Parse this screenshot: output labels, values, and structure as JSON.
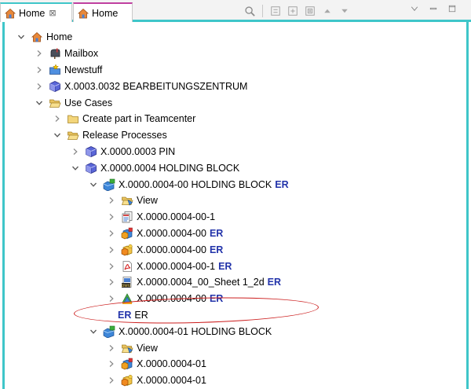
{
  "tabs": [
    {
      "label": "Home",
      "close": "⊠"
    },
    {
      "label": "Home"
    }
  ],
  "toolbar": {
    "icons": [
      "search-icon",
      "collapse-all-icon",
      "expand-icon",
      "expand-all-icon",
      "up-icon",
      "down-icon"
    ],
    "window": [
      "view-menu-icon",
      "minimize-icon",
      "maximize-icon"
    ]
  },
  "colors": {
    "accent": "#3fc6c9",
    "er": "#2233aa",
    "highlight": "#cc1e1e"
  },
  "tree": [
    {
      "level": 0,
      "exp": "open",
      "icon": "home",
      "label": "Home"
    },
    {
      "level": 1,
      "exp": "closed",
      "icon": "mailbox",
      "label": "Mailbox"
    },
    {
      "level": 1,
      "exp": "closed",
      "icon": "newstuff",
      "label": "Newstuff"
    },
    {
      "level": 1,
      "exp": "closed",
      "icon": "cube",
      "label": "X.0003.0032 BEARBEITUNGSZENTRUM"
    },
    {
      "level": 1,
      "exp": "open",
      "icon": "folder-open",
      "label": "Use Cases"
    },
    {
      "level": 2,
      "exp": "closed",
      "icon": "folder",
      "label": "Create part in Teamcenter"
    },
    {
      "level": 2,
      "exp": "open",
      "icon": "folder-open",
      "label": "Release Processes"
    },
    {
      "level": 3,
      "exp": "closed",
      "icon": "cube",
      "label": "X.0000.0003 PIN"
    },
    {
      "level": 3,
      "exp": "open",
      "icon": "cube",
      "label": "X.0000.0004 HOLDING BLOCK"
    },
    {
      "level": 4,
      "exp": "open",
      "icon": "revision",
      "label": "X.0000.0004-00 HOLDING BLOCK",
      "er": "ER"
    },
    {
      "level": 5,
      "exp": "closed",
      "icon": "view",
      "label": "View"
    },
    {
      "level": 5,
      "exp": "closed",
      "icon": "doc-multi",
      "label": "X.0000.0004-00-1"
    },
    {
      "level": 5,
      "exp": "closed",
      "icon": "dataset",
      "label": "X.0000.0004-00",
      "er": "ER"
    },
    {
      "level": 5,
      "exp": "closed",
      "icon": "dataset2",
      "label": "X.0000.0004-00",
      "er": "ER"
    },
    {
      "level": 5,
      "exp": "closed",
      "icon": "pdf",
      "label": "X.0000.0004-00-1",
      "er": "ER"
    },
    {
      "level": 5,
      "exp": "closed",
      "icon": "dwg",
      "label": "X.0000.0004_00_Sheet 1_2d",
      "er": "ER"
    },
    {
      "level": 5,
      "exp": "closed",
      "icon": "model",
      "label": "X.0000.0004-00",
      "er": "ER"
    },
    {
      "level": 5,
      "exp": "none",
      "icon": "none",
      "label": "ER",
      "erLead": "ER"
    },
    {
      "level": 4,
      "exp": "open",
      "icon": "revision",
      "label": "X.0000.0004-01 HOLDING BLOCK"
    },
    {
      "level": 5,
      "exp": "closed",
      "icon": "view",
      "label": "View"
    },
    {
      "level": 5,
      "exp": "closed",
      "icon": "dataset",
      "label": "X.0000.0004-01"
    },
    {
      "level": 5,
      "exp": "closed",
      "icon": "dataset2",
      "label": "X.0000.0004-01"
    }
  ]
}
